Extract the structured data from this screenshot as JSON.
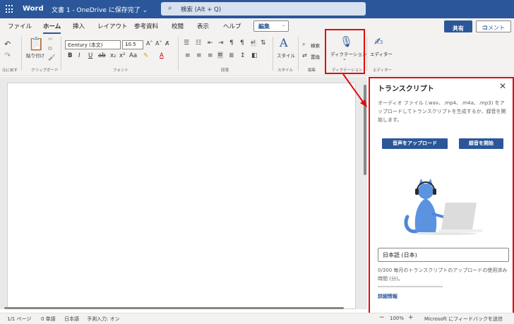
{
  "titlebar": {
    "app_name": "Word",
    "doc_title": "文書 1 - OneDrive に保存完了 ⌄",
    "search_icon": "search-icon",
    "search_placeholder": "検索 (Alt + Q)"
  },
  "tabs": {
    "items": [
      "ファイル",
      "ホーム",
      "挿入",
      "レイアウト",
      "参考資料",
      "校閲",
      "表示",
      "ヘルプ"
    ],
    "active": "ホーム",
    "edit_mode": "編集",
    "share": "共有",
    "comment": "コメント"
  },
  "ribbon": {
    "undo_label": "元に戻す",
    "paste_label": "貼り付け",
    "clipboard_label": "クリップボード",
    "font_name": "Century (本文)",
    "font_size": "10.5",
    "font_group_label": "フォント",
    "paragraph_label": "段落",
    "style_button": "スタイル",
    "style_group_label": "スタイル",
    "find_label": "検索",
    "replace_label": "置換",
    "edit_group_label": "編集",
    "dictation_button": "ディクテーション",
    "dictation_group_label": "ディクテーション",
    "editor_button": "エディター",
    "editor_group_label": "エディター",
    "format_buttons": [
      "B",
      "I",
      "U",
      "ab",
      "x₂",
      "x²",
      "Aa",
      "A"
    ]
  },
  "transcript_pane": {
    "title": "トランスクリプト",
    "description": "オーディオ ファイル (.wav、.mp4、.m4a、.mp3) をアップロードしてトランスクリプトを生成するか、録音を開始します。",
    "upload_button": "音声をアップロード",
    "record_button": "録音を開始",
    "language": "日本語 (日本)",
    "usage_text": "0/300 毎月のトランスクリプトのアップロードの使用済み時間 (分)。",
    "usage_fraction": 0.0,
    "more_info": "詳細情報"
  },
  "statusbar": {
    "page": "1/1 ページ",
    "words": "0 単語",
    "language": "日本語",
    "prediction": "予測入力: オン",
    "zoom": "100%",
    "feedback": "Microsoft にフィードバックを送信"
  },
  "colors": {
    "brand": "#2b579a",
    "highlight_red": "#e00b0b"
  }
}
